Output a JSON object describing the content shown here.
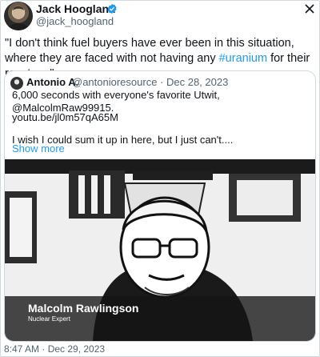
{
  "tweet": {
    "author_name": "Jack Hoogland",
    "handle": "@jack_hoogland",
    "text_before": "\"I don't think fuel buyers have ever been in this situation, where they are faced with not having any ",
    "hashtag": "#uranium",
    "text_after": " for their reactors.\"",
    "timestamp": "8:47 AM · Dec 29, 2023"
  },
  "quoted": {
    "author_name": "Antonio A.",
    "meta": "@antonioresource · Dec 28, 2023",
    "line1": "6,000 seconds with everyone's favorite Utwit,  @MalcolmRaw99915.",
    "line2": "youtu.be/jl0m57qA65M",
    "line3": "I wish I could sum it up in here, but I just can't....",
    "show_more": "Show more"
  },
  "media": {
    "caption_name": "Malcolm Rawlingson",
    "caption_title": "Nuclear Expert"
  },
  "icons": {
    "verified": "verified-badge-icon",
    "close": "close-icon"
  },
  "colors": {
    "accent": "#1d9bf0",
    "muted": "#536471",
    "border": "#cfd9de"
  }
}
